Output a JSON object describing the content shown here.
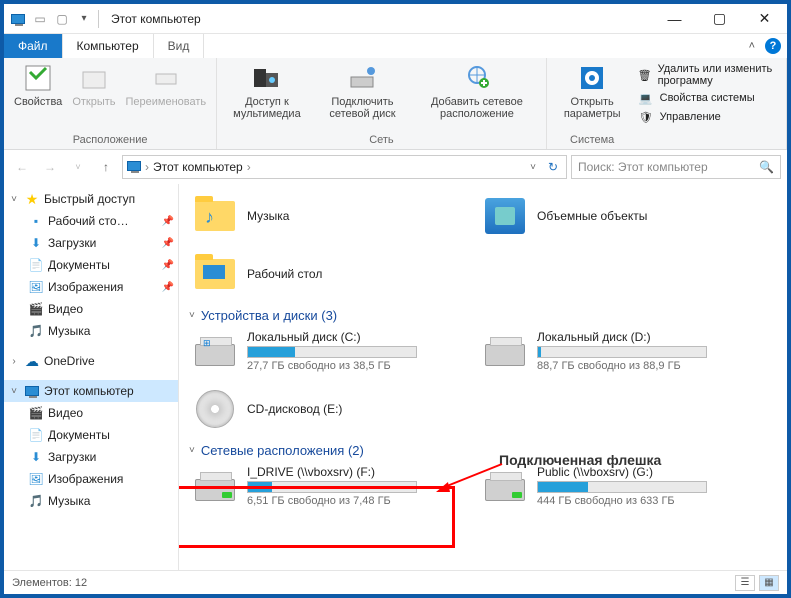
{
  "titlebar": {
    "title": "Этот компьютер"
  },
  "tabs": {
    "file": "Файл",
    "computer": "Компьютер",
    "view": "Вид"
  },
  "ribbon": {
    "group_location": "Расположение",
    "properties": "Свойства",
    "open": "Открыть",
    "rename": "Переименовать",
    "group_network": "Сеть",
    "media": "Доступ к мультимедиа",
    "map_drive": "Подключить сетевой диск",
    "add_netloc": "Добавить сетевое расположение",
    "group_system": "Система",
    "open_params": "Открыть параметры",
    "uninstall": "Удалить или изменить программу",
    "sys_props": "Свойства системы",
    "manage": "Управление"
  },
  "breadcrumb": {
    "root": "Этот компьютер"
  },
  "search_placeholder": "Поиск: Этот компьютер",
  "sidebar": {
    "quick": "Быстрый доступ",
    "desktop": "Рабочий сто…",
    "downloads": "Загрузки",
    "documents": "Документы",
    "pictures": "Изображения",
    "videos": "Видео",
    "music": "Музыка",
    "onedrive": "OneDrive",
    "thispc": "Этот компьютер",
    "tp_videos": "Видео",
    "tp_documents": "Документы",
    "tp_downloads": "Загрузки",
    "tp_pictures": "Изображения",
    "tp_music": "Музыка"
  },
  "folders": {
    "music": "Музыка",
    "objects3d": "Объемные объекты",
    "desktop": "Рабочий стол"
  },
  "section_drives": "Устройства и диски (3)",
  "section_network": "Сетевые расположения (2)",
  "drives": {
    "c": {
      "name": "Локальный диск (C:)",
      "sub": "27,7 ГБ свободно из 38,5 ГБ",
      "fill": 28
    },
    "d": {
      "name": "Локальный диск (D:)",
      "sub": "88,7 ГБ свободно из 88,9 ГБ",
      "fill": 2
    },
    "e": {
      "name": "CD-дисковод (E:)"
    },
    "f": {
      "name": "I_DRIVE (\\\\vboxsrv) (F:)",
      "sub": "6,51 ГБ свободно из 7,48 ГБ",
      "fill": 14
    },
    "g": {
      "name": "Public (\\\\vboxsrv) (G:)",
      "sub": "444 ГБ свободно из 633 ГБ",
      "fill": 30
    }
  },
  "annotation": "Подключенная флешка",
  "status": {
    "count": "Элементов: 12"
  }
}
